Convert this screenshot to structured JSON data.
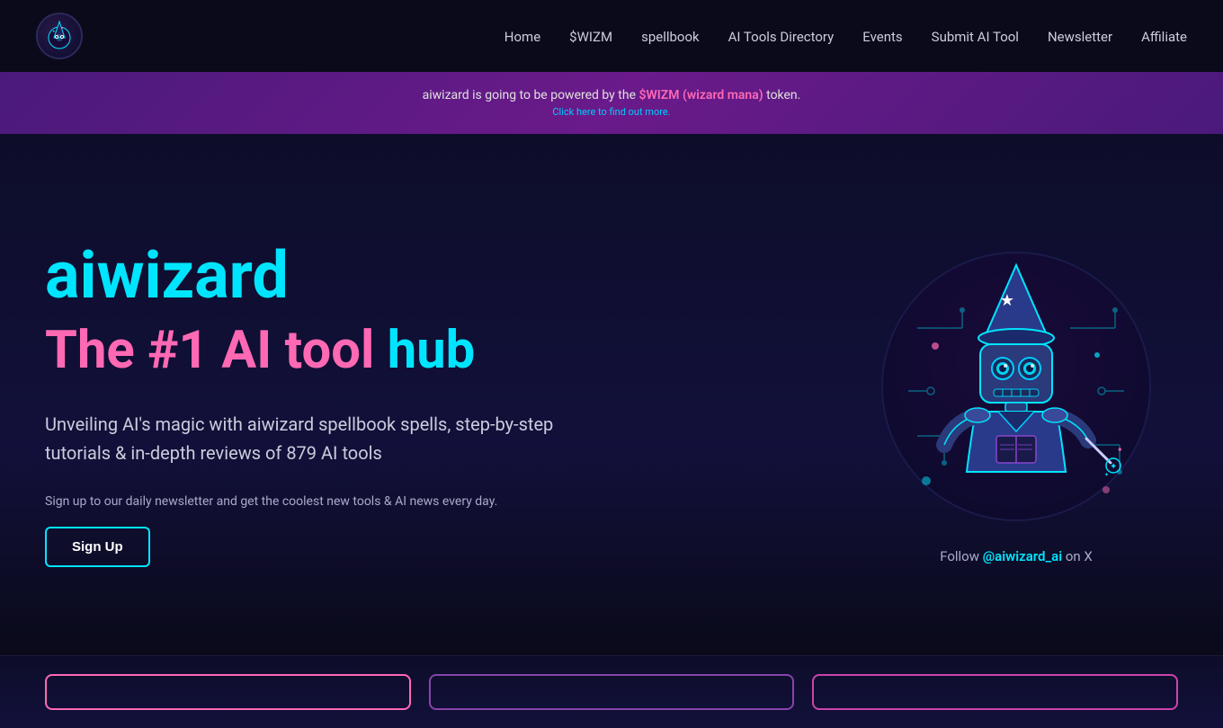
{
  "nav": {
    "logo_alt": "aiwizard logo",
    "links": [
      {
        "label": "Home",
        "href": "#"
      },
      {
        "label": "$WIZM",
        "href": "#"
      },
      {
        "label": "spellbook",
        "href": "#"
      },
      {
        "label": "AI Tools Directory",
        "href": "#"
      },
      {
        "label": "Events",
        "href": "#"
      },
      {
        "label": "Submit AI Tool",
        "href": "#"
      },
      {
        "label": "Newsletter",
        "href": "#"
      },
      {
        "label": "Affiliate",
        "href": "#"
      }
    ]
  },
  "announcement": {
    "text_plain": "aiwizard is going to be powered by the ",
    "text_highlight": "$WIZM (wizard mana)",
    "text_end": " token.",
    "click_text": "Click here to find out more."
  },
  "hero": {
    "title_main": "aiwizard",
    "subtitle_the": "The",
    "subtitle_number": "#1",
    "subtitle_ai": "AI",
    "subtitle_tool": "tool",
    "subtitle_hub": "hub",
    "description": "Unveiling AI's magic with aiwizard spellbook spells, step-by-step tutorials & in-depth reviews of 879 AI tools",
    "newsletter_text": "Sign up to our daily newsletter and get the coolest new tools & AI news every day.",
    "cta_button": "Sign Up",
    "follow_prefix": "Follow ",
    "follow_handle": "@aiwizard_ai",
    "follow_suffix": " on X"
  },
  "bottom_cards": [
    {
      "id": 1
    },
    {
      "id": 2
    },
    {
      "id": 3
    }
  ]
}
